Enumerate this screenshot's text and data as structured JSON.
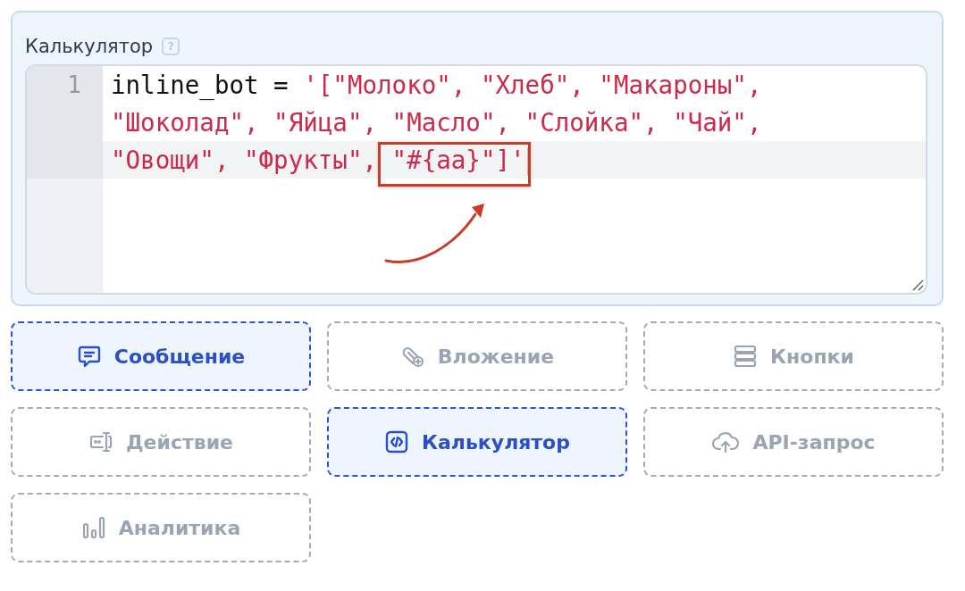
{
  "calculator": {
    "label": "Калькулятор",
    "help": "?",
    "editor": {
      "line_numbers": [
        "1"
      ],
      "code": [
        {
          "kind": "plain",
          "text": "inline_bot = "
        },
        {
          "kind": "string",
          "text": "'[\"Молоко\", \"Хлеб\", \"Макароны\", \"Шоколад\", \"Яйца\", \"Масло\", \"Слойка\", \"Чай\", \"Овощи\", \"Фрукты\", "
        },
        {
          "kind": "boxed_string",
          "text": "\"#{aa}\"]'"
        }
      ]
    }
  },
  "blocks": [
    {
      "label": "Сообщение",
      "kind": "message",
      "selected": true
    },
    {
      "label": "Вложение",
      "kind": "attachment",
      "selected": false
    },
    {
      "label": "Кнопки",
      "kind": "buttons",
      "selected": false
    },
    {
      "label": "Действие",
      "kind": "action",
      "selected": false
    },
    {
      "label": "Калькулятор",
      "kind": "code",
      "selected": true
    },
    {
      "label": "API-запрос",
      "kind": "cloud",
      "selected": false
    },
    {
      "label": "Аналитика",
      "kind": "analytics",
      "selected": false
    }
  ]
}
